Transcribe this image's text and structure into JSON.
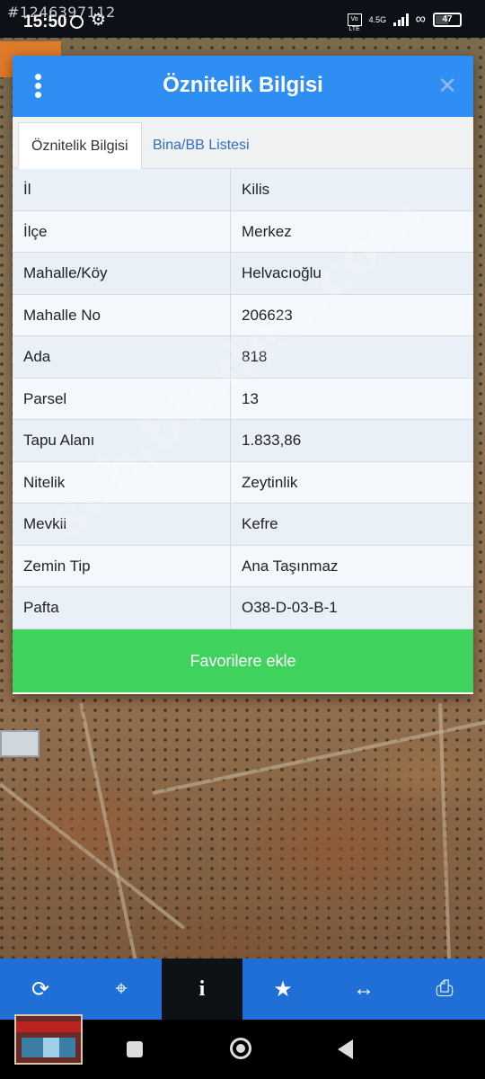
{
  "watermark_id": "#1246397112",
  "status_bar": {
    "time": "15:50",
    "network_badge": "Vo LTE",
    "network_type": "4.5G",
    "battery": "47"
  },
  "dialog": {
    "title": "Öznitelik Bilgisi",
    "tabs": [
      {
        "label": "Öznitelik Bilgisi",
        "active": true
      },
      {
        "label": "Bina/BB Listesi",
        "active": false
      }
    ],
    "rows": [
      {
        "key": "İl",
        "value": "Kilis"
      },
      {
        "key": "İlçe",
        "value": "Merkez"
      },
      {
        "key": "Mahalle/Köy",
        "value": "Helvacıoğlu"
      },
      {
        "key": "Mahalle No",
        "value": "206623"
      },
      {
        "key": "Ada",
        "value": "818"
      },
      {
        "key": "Parsel",
        "value": "13"
      },
      {
        "key": "Tapu Alanı",
        "value": "1.833,86"
      },
      {
        "key": "Nitelik",
        "value": "Zeytinlik"
      },
      {
        "key": "Mevkii",
        "value": "Kefre"
      },
      {
        "key": "Zemin Tip",
        "value": "Ana Taşınmaz"
      },
      {
        "key": "Pafta",
        "value": "O38-D-03-B-1"
      }
    ],
    "favorite_button": "Favorilere ekle"
  },
  "toolbar": {
    "items": [
      {
        "icon": "refresh-icon",
        "active": false
      },
      {
        "icon": "locate-icon",
        "active": false
      },
      {
        "icon": "info-icon",
        "active": true
      },
      {
        "icon": "star-icon",
        "active": false
      },
      {
        "icon": "measure-icon",
        "active": false
      },
      {
        "icon": "print-icon",
        "active": false
      }
    ]
  },
  "site_watermark": "sahibinden.com",
  "colors": {
    "header_blue": "#2f8ef3",
    "button_green": "#3fd25c",
    "toolbar_blue": "#1f6fd6"
  }
}
